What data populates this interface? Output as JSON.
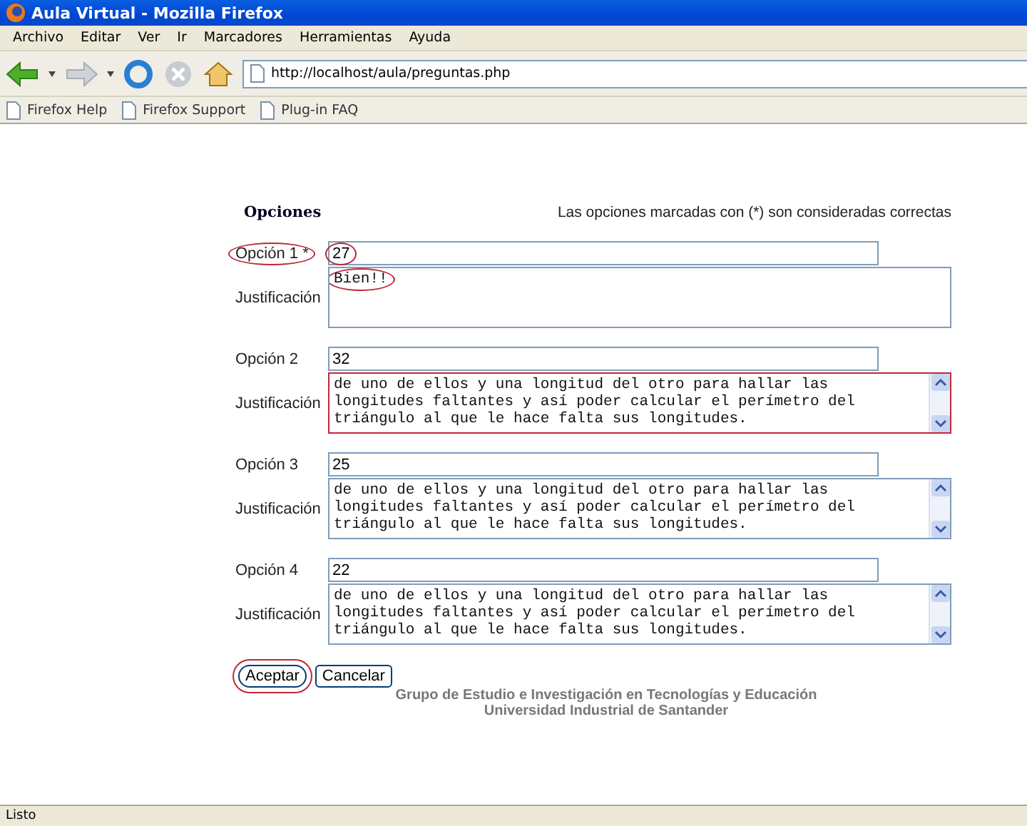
{
  "window": {
    "title": "Aula Virtual - Mozilla Firefox"
  },
  "menu": [
    "Archivo",
    "Editar",
    "Ver",
    "Ir",
    "Marcadores",
    "Herramientas",
    "Ayuda"
  ],
  "address": {
    "value": "http://localhost/aula/preguntas.php"
  },
  "bookmarks": [
    "Firefox Help",
    "Firefox Support",
    "Plug-in FAQ"
  ],
  "form": {
    "heading": "Opciones",
    "note": "Las opciones marcadas con (*) son consideradas correctas",
    "options": [
      {
        "label": "Opción 1 *",
        "label_circled": true,
        "value": "27",
        "value_circled": true,
        "justification_label": "Justificación",
        "justification": [
          "Bien!!"
        ],
        "justification_circled": true,
        "justification_outlined": false
      },
      {
        "label": "Opción 2",
        "label_circled": false,
        "value": "32",
        "value_circled": false,
        "justification_label": "Justificación",
        "justification": [
          "de uno de ellos y una longitud del otro para hallar las",
          "longitudes faltantes y así poder calcular el perímetro del",
          "triángulo al que le hace falta sus longitudes."
        ],
        "justification_circled": false,
        "justification_outlined": true
      },
      {
        "label": "Opción 3",
        "label_circled": false,
        "value": "25",
        "value_circled": false,
        "justification_label": "Justificación",
        "justification": [
          "de uno de ellos y una longitud del otro para hallar las",
          "longitudes faltantes y así poder calcular el perímetro del",
          "triángulo al que le hace falta sus longitudes."
        ],
        "justification_circled": false,
        "justification_outlined": false
      },
      {
        "label": "Opción 4",
        "label_circled": false,
        "value": "22",
        "value_circled": false,
        "justification_label": "Justificación",
        "justification": [
          "de uno de ellos y una longitud del otro para hallar las",
          "longitudes faltantes y así poder calcular el perímetro del",
          "triángulo al que le hace falta sus longitudes."
        ],
        "justification_circled": false,
        "justification_outlined": false
      }
    ],
    "buttons": [
      {
        "label": "Aceptar",
        "circled": true
      },
      {
        "label": "Cancelar",
        "circled": false
      }
    ]
  },
  "footer": [
    "Grupo de Estudio e Investigación en Tecnologías y Educación",
    "Universidad Industrial de Santander"
  ],
  "status_bar": "Listo"
}
